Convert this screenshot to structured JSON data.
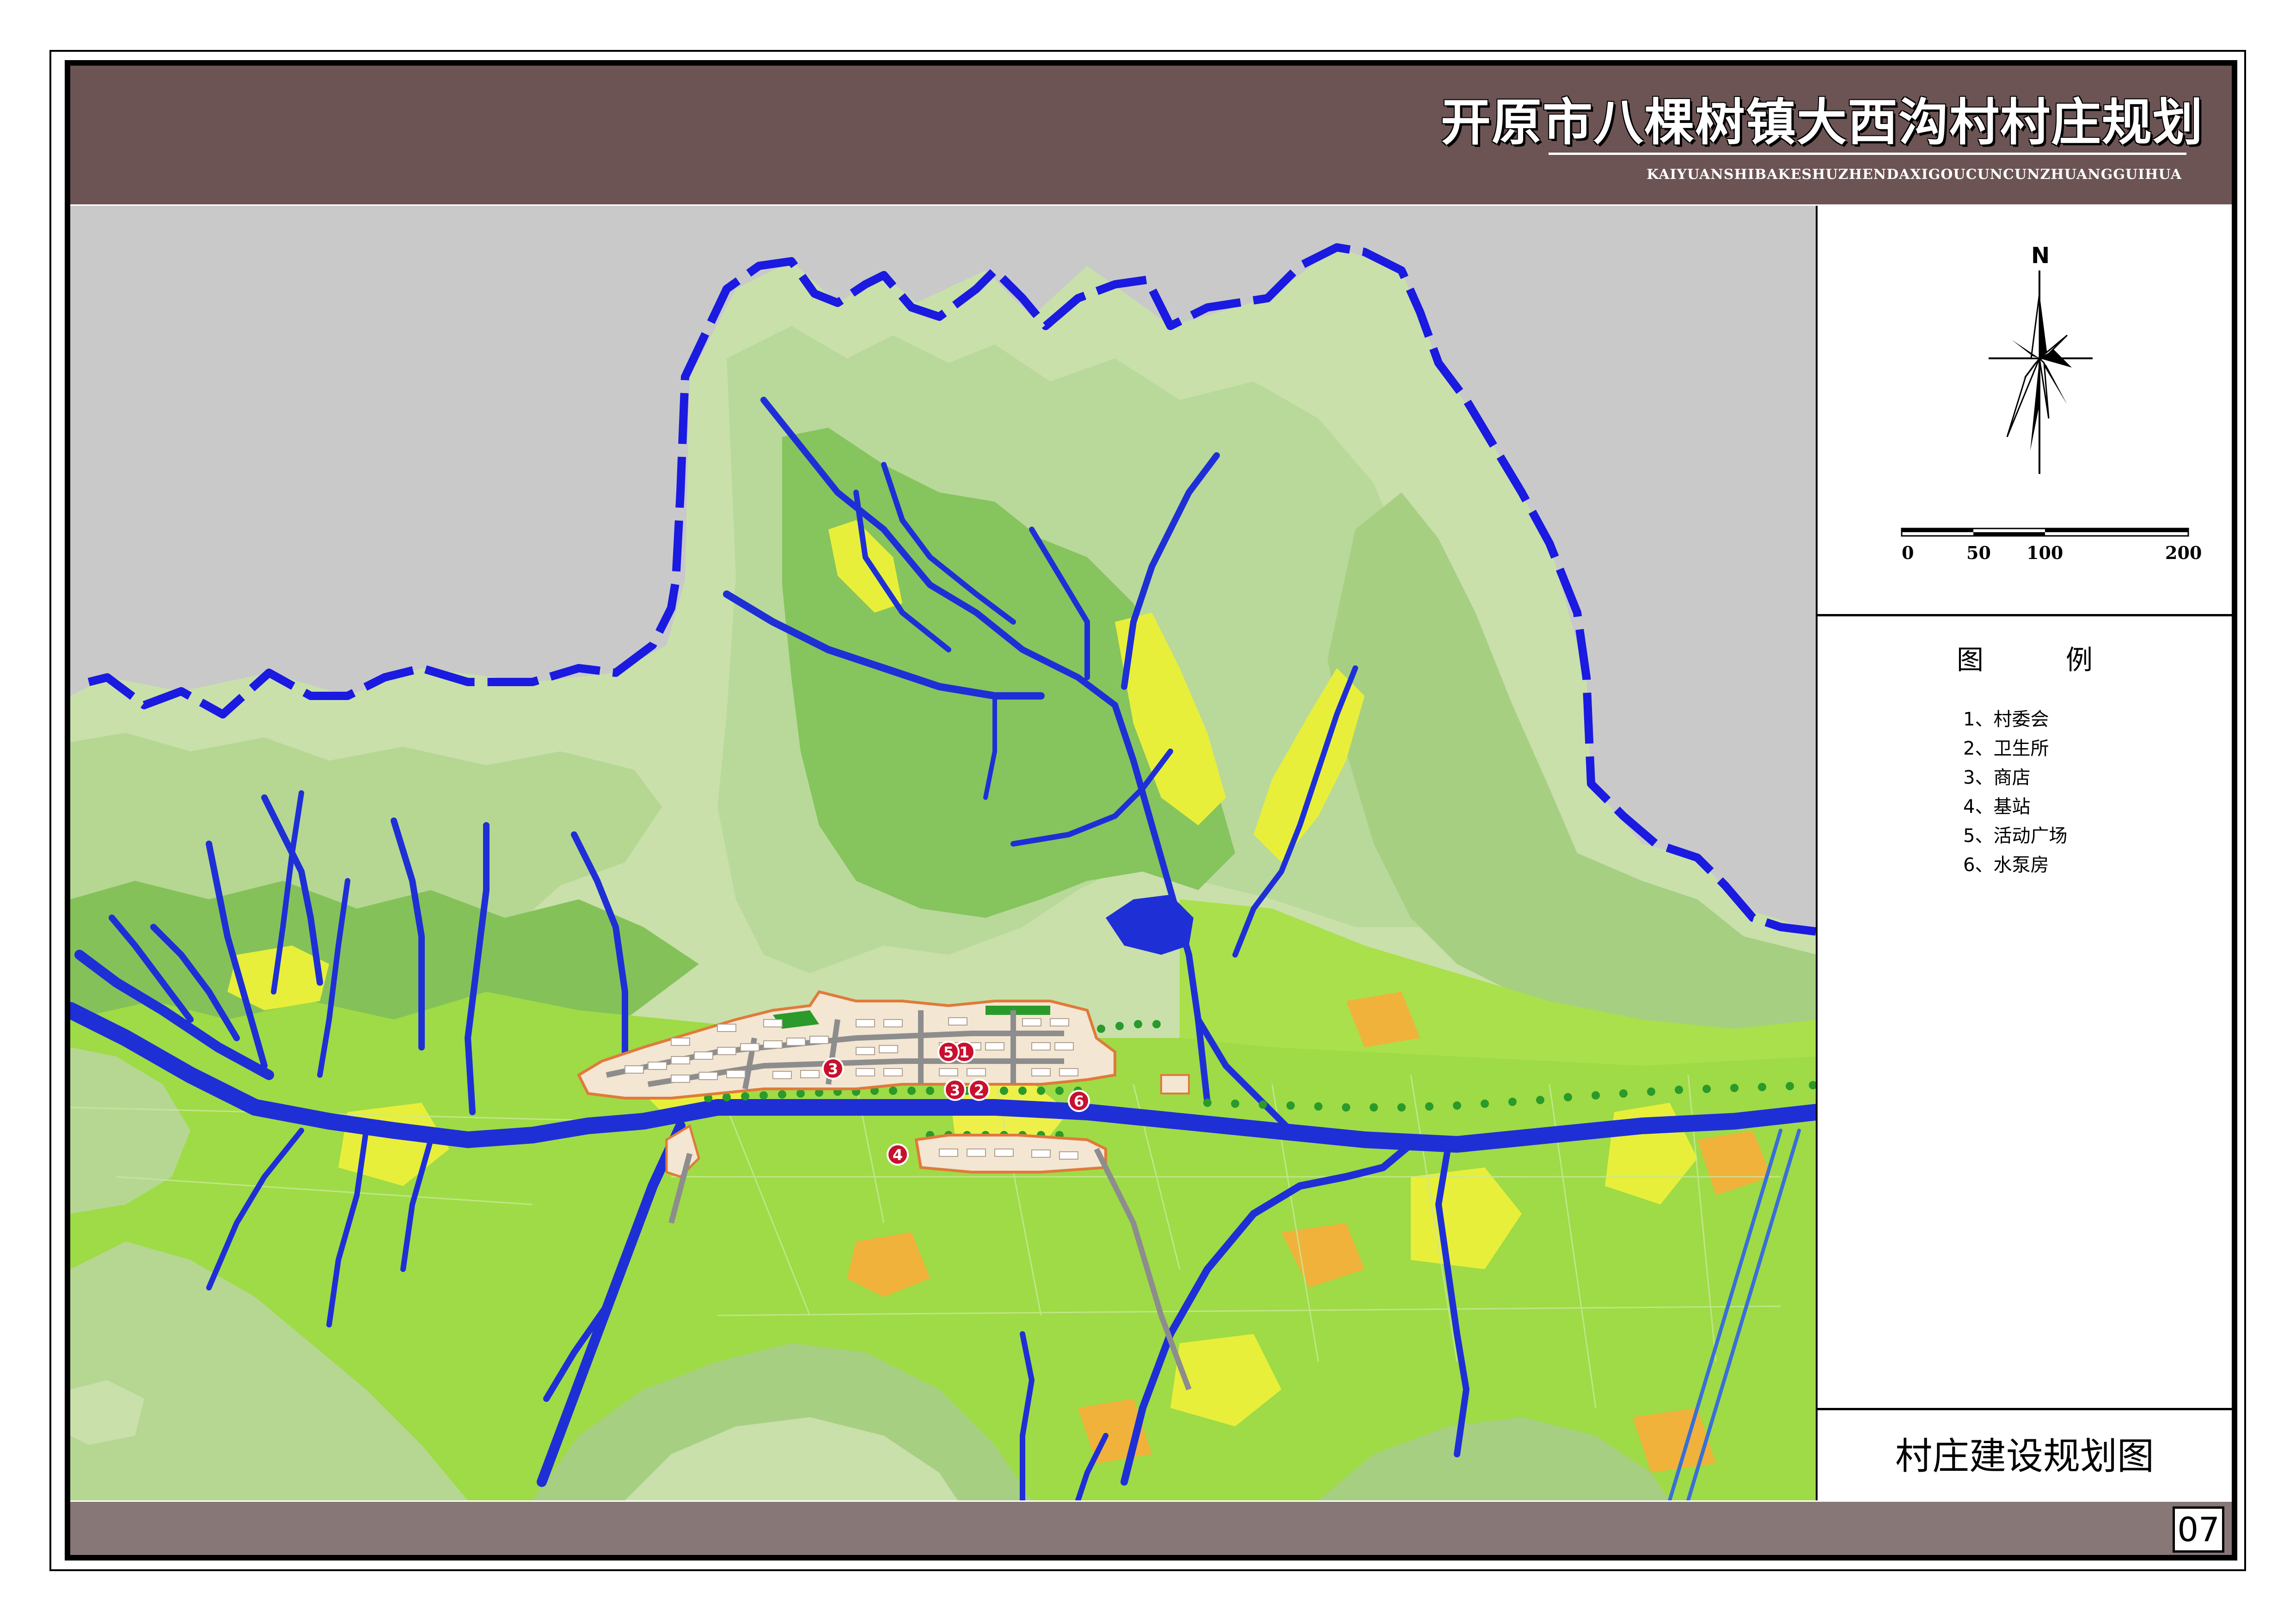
{
  "title": {
    "main": "开原市八棵树镇大西沟村村庄规划",
    "pinyin": "KAIYUANSHIBAKESHUZHENDAXIGOUCUNCUNZHUANGGUIHUA"
  },
  "north_arrow": {
    "label": "N"
  },
  "scale_bar": {
    "ticks": [
      "0",
      "50",
      "100",
      "200"
    ]
  },
  "legend": {
    "title": "图　例",
    "items": [
      {
        "label": "1、村委会"
      },
      {
        "label": "2、卫生所"
      },
      {
        "label": "3、商店"
      },
      {
        "label": "4、基站"
      },
      {
        "label": "5、活动广场"
      },
      {
        "label": "6、水泵房"
      }
    ]
  },
  "drawing_title": "村庄建设规划图",
  "page_number": "07",
  "map_markers": [
    {
      "num": "1",
      "label": "村委会"
    },
    {
      "num": "2",
      "label": "卫生所"
    },
    {
      "num": "3",
      "label": "商店"
    },
    {
      "num": "3",
      "label": "商店"
    },
    {
      "num": "4",
      "label": "基站"
    },
    {
      "num": "5",
      "label": "活动广场"
    },
    {
      "num": "6",
      "label": "水泵房"
    }
  ],
  "colors": {
    "header": "#6c5454",
    "footer": "#877777",
    "outside_area": "#c9c9c9",
    "boundary": "#1a1ae0",
    "water": "#1f2fd6",
    "hill_light": "#cfe3b0",
    "hill_mid": "#a8cf86",
    "hill_dark": "#7fbf5a",
    "field_green": "#8fdc3a",
    "field_yellow": "#e8ef3a",
    "field_orange": "#f0b23a",
    "settlement": "#f3e6d2",
    "marker": "#c8102e"
  }
}
